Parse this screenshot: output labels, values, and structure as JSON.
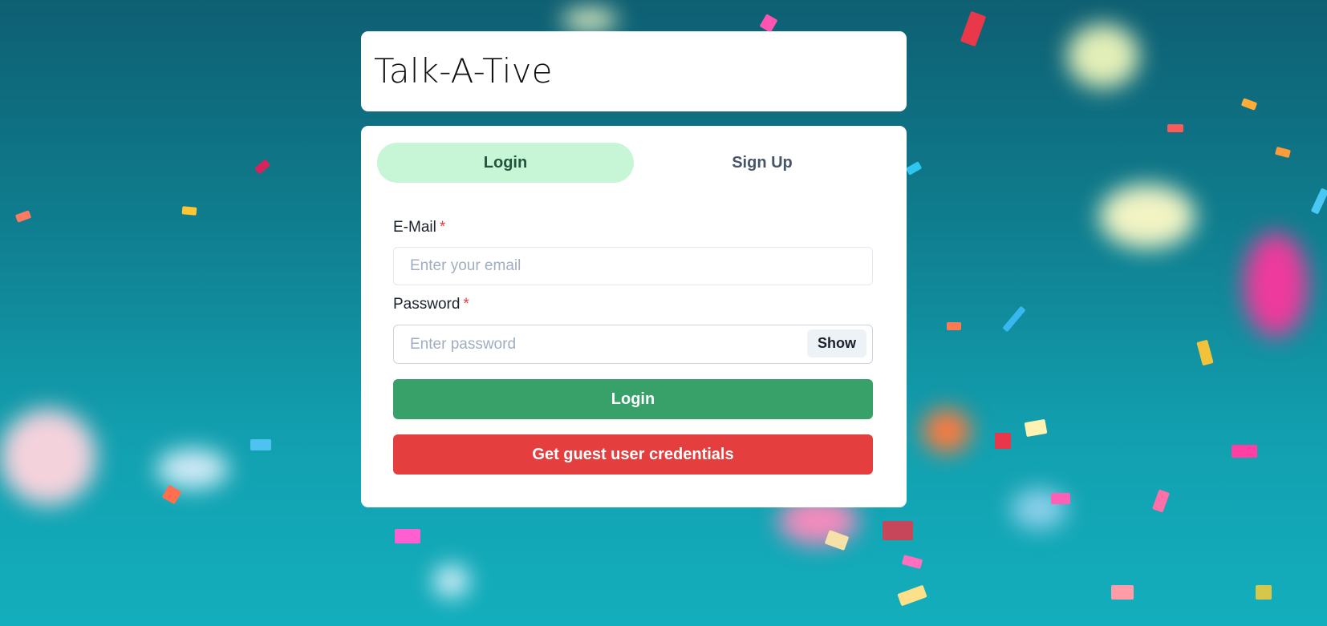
{
  "app": {
    "title": "Talk-A-Tive"
  },
  "tabs": [
    {
      "label": "Login",
      "active": true
    },
    {
      "label": "Sign Up",
      "active": false
    }
  ],
  "form": {
    "email": {
      "label": "E-Mail",
      "required_marker": "*",
      "placeholder": "Enter your email",
      "value": ""
    },
    "password": {
      "label": "Password",
      "required_marker": "*",
      "placeholder": "Enter password",
      "value": "",
      "toggle_label": "Show"
    },
    "login_button": "Login",
    "guest_button": "Get guest user credentials"
  },
  "colors": {
    "active_tab_bg": "#c6f6d5",
    "login_button": "#38a169",
    "guest_button": "#e53e3e",
    "required_marker": "#e53e3e"
  }
}
